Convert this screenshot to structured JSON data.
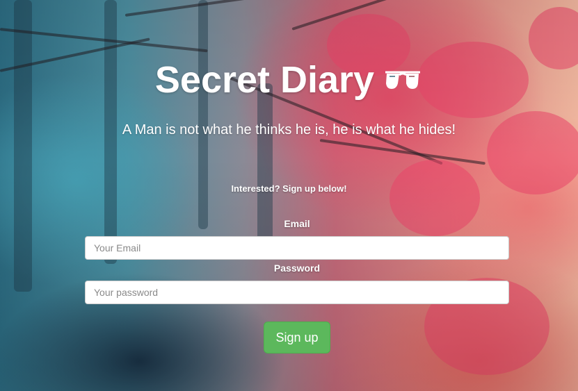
{
  "hero": {
    "title": "Secret Diary",
    "title_icon": "sunglasses-icon",
    "subtitle": "A Man is not what he thinks he is, he is what he hides!"
  },
  "signup": {
    "prompt": "Interested? Sign up below!",
    "email_label": "Email",
    "email_placeholder": "Your Email",
    "email_value": "",
    "password_label": "Password",
    "password_placeholder": "Your password",
    "password_value": "",
    "submit_label": "Sign up"
  },
  "colors": {
    "button": "#5cb85c",
    "text": "#ffffff"
  }
}
